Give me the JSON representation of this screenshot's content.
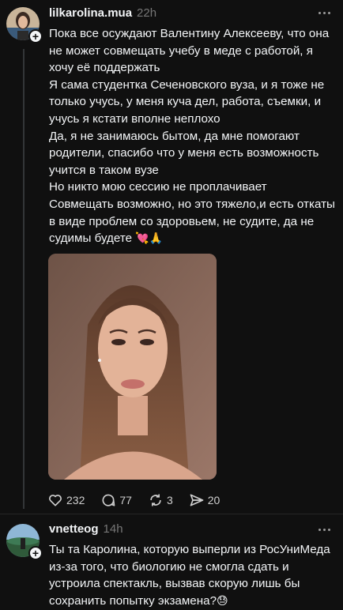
{
  "post1": {
    "username": "lilkarolina.mua",
    "time": "22h",
    "lines": [
      "Пока все осуждают Валентину Алексееву, что она не может совмещать учебу в меде с работой, я хочу её поддержать",
      "Я сама студентка Сеченовского вуза, и я тоже не только учусь, у меня куча дел, работа, съемки, и учусь я кстати вполне неплохо",
      "Да, я не занимаюсь бытом, да мне помогают родители, спасибо что у меня есть возможность учится в таком вузе",
      "Но никто мою сессию не проплачивает",
      "Совмещать возможно, но это тяжело,и есть откаты в виде проблем со здоровьем, не судите, да не судимы будете"
    ],
    "emoji_end": "💘🙏",
    "likes": "232",
    "comments": "77",
    "reposts": "3",
    "shares": "20"
  },
  "post2": {
    "username": "vnetteog",
    "time": "14h",
    "text": "Ты та Каролина, которую выперли из РосУниМеда из-за того, что биологию не смогла сдать и устроила спектакль, вызвав скорую лишь бы сохранить попытку экзамена?",
    "emoji_end": "😓"
  },
  "colors": {
    "background": "#101010",
    "text": "#f3f5f7",
    "secondary": "#777777",
    "divider": "#262626"
  },
  "icons": [
    "more-icon",
    "heart-icon",
    "comment-icon",
    "repost-icon",
    "share-icon",
    "follow-plus-icon"
  ]
}
